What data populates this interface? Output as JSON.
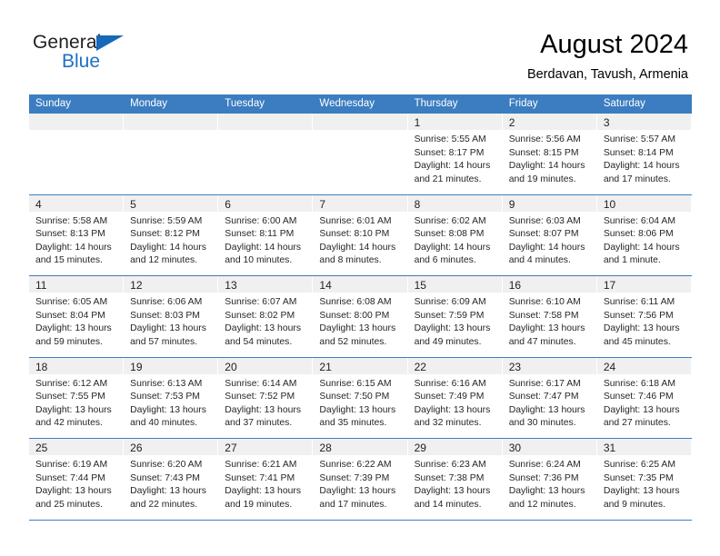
{
  "brand": {
    "line1": "General",
    "line2": "Blue",
    "flag_icon": "triangle-flag-icon",
    "accent_color": "#1569b8"
  },
  "header": {
    "title": "August 2024",
    "subtitle": "Berdavan, Tavush, Armenia"
  },
  "theme": {
    "header_blue": "#3b7dc0",
    "day_band_gray": "#f0f0f0",
    "text_color": "#262626"
  },
  "weekdays": [
    "Sunday",
    "Monday",
    "Tuesday",
    "Wednesday",
    "Thursday",
    "Friday",
    "Saturday"
  ],
  "weeks": [
    [
      {
        "day": "",
        "lines": []
      },
      {
        "day": "",
        "lines": []
      },
      {
        "day": "",
        "lines": []
      },
      {
        "day": "",
        "lines": []
      },
      {
        "day": "1",
        "lines": [
          "Sunrise: 5:55 AM",
          "Sunset: 8:17 PM",
          "Daylight: 14 hours",
          "and 21 minutes."
        ]
      },
      {
        "day": "2",
        "lines": [
          "Sunrise: 5:56 AM",
          "Sunset: 8:15 PM",
          "Daylight: 14 hours",
          "and 19 minutes."
        ]
      },
      {
        "day": "3",
        "lines": [
          "Sunrise: 5:57 AM",
          "Sunset: 8:14 PM",
          "Daylight: 14 hours",
          "and 17 minutes."
        ]
      }
    ],
    [
      {
        "day": "4",
        "lines": [
          "Sunrise: 5:58 AM",
          "Sunset: 8:13 PM",
          "Daylight: 14 hours",
          "and 15 minutes."
        ]
      },
      {
        "day": "5",
        "lines": [
          "Sunrise: 5:59 AM",
          "Sunset: 8:12 PM",
          "Daylight: 14 hours",
          "and 12 minutes."
        ]
      },
      {
        "day": "6",
        "lines": [
          "Sunrise: 6:00 AM",
          "Sunset: 8:11 PM",
          "Daylight: 14 hours",
          "and 10 minutes."
        ]
      },
      {
        "day": "7",
        "lines": [
          "Sunrise: 6:01 AM",
          "Sunset: 8:10 PM",
          "Daylight: 14 hours",
          "and 8 minutes."
        ]
      },
      {
        "day": "8",
        "lines": [
          "Sunrise: 6:02 AM",
          "Sunset: 8:08 PM",
          "Daylight: 14 hours",
          "and 6 minutes."
        ]
      },
      {
        "day": "9",
        "lines": [
          "Sunrise: 6:03 AM",
          "Sunset: 8:07 PM",
          "Daylight: 14 hours",
          "and 4 minutes."
        ]
      },
      {
        "day": "10",
        "lines": [
          "Sunrise: 6:04 AM",
          "Sunset: 8:06 PM",
          "Daylight: 14 hours",
          "and 1 minute."
        ]
      }
    ],
    [
      {
        "day": "11",
        "lines": [
          "Sunrise: 6:05 AM",
          "Sunset: 8:04 PM",
          "Daylight: 13 hours",
          "and 59 minutes."
        ]
      },
      {
        "day": "12",
        "lines": [
          "Sunrise: 6:06 AM",
          "Sunset: 8:03 PM",
          "Daylight: 13 hours",
          "and 57 minutes."
        ]
      },
      {
        "day": "13",
        "lines": [
          "Sunrise: 6:07 AM",
          "Sunset: 8:02 PM",
          "Daylight: 13 hours",
          "and 54 minutes."
        ]
      },
      {
        "day": "14",
        "lines": [
          "Sunrise: 6:08 AM",
          "Sunset: 8:00 PM",
          "Daylight: 13 hours",
          "and 52 minutes."
        ]
      },
      {
        "day": "15",
        "lines": [
          "Sunrise: 6:09 AM",
          "Sunset: 7:59 PM",
          "Daylight: 13 hours",
          "and 49 minutes."
        ]
      },
      {
        "day": "16",
        "lines": [
          "Sunrise: 6:10 AM",
          "Sunset: 7:58 PM",
          "Daylight: 13 hours",
          "and 47 minutes."
        ]
      },
      {
        "day": "17",
        "lines": [
          "Sunrise: 6:11 AM",
          "Sunset: 7:56 PM",
          "Daylight: 13 hours",
          "and 45 minutes."
        ]
      }
    ],
    [
      {
        "day": "18",
        "lines": [
          "Sunrise: 6:12 AM",
          "Sunset: 7:55 PM",
          "Daylight: 13 hours",
          "and 42 minutes."
        ]
      },
      {
        "day": "19",
        "lines": [
          "Sunrise: 6:13 AM",
          "Sunset: 7:53 PM",
          "Daylight: 13 hours",
          "and 40 minutes."
        ]
      },
      {
        "day": "20",
        "lines": [
          "Sunrise: 6:14 AM",
          "Sunset: 7:52 PM",
          "Daylight: 13 hours",
          "and 37 minutes."
        ]
      },
      {
        "day": "21",
        "lines": [
          "Sunrise: 6:15 AM",
          "Sunset: 7:50 PM",
          "Daylight: 13 hours",
          "and 35 minutes."
        ]
      },
      {
        "day": "22",
        "lines": [
          "Sunrise: 6:16 AM",
          "Sunset: 7:49 PM",
          "Daylight: 13 hours",
          "and 32 minutes."
        ]
      },
      {
        "day": "23",
        "lines": [
          "Sunrise: 6:17 AM",
          "Sunset: 7:47 PM",
          "Daylight: 13 hours",
          "and 30 minutes."
        ]
      },
      {
        "day": "24",
        "lines": [
          "Sunrise: 6:18 AM",
          "Sunset: 7:46 PM",
          "Daylight: 13 hours",
          "and 27 minutes."
        ]
      }
    ],
    [
      {
        "day": "25",
        "lines": [
          "Sunrise: 6:19 AM",
          "Sunset: 7:44 PM",
          "Daylight: 13 hours",
          "and 25 minutes."
        ]
      },
      {
        "day": "26",
        "lines": [
          "Sunrise: 6:20 AM",
          "Sunset: 7:43 PM",
          "Daylight: 13 hours",
          "and 22 minutes."
        ]
      },
      {
        "day": "27",
        "lines": [
          "Sunrise: 6:21 AM",
          "Sunset: 7:41 PM",
          "Daylight: 13 hours",
          "and 19 minutes."
        ]
      },
      {
        "day": "28",
        "lines": [
          "Sunrise: 6:22 AM",
          "Sunset: 7:39 PM",
          "Daylight: 13 hours",
          "and 17 minutes."
        ]
      },
      {
        "day": "29",
        "lines": [
          "Sunrise: 6:23 AM",
          "Sunset: 7:38 PM",
          "Daylight: 13 hours",
          "and 14 minutes."
        ]
      },
      {
        "day": "30",
        "lines": [
          "Sunrise: 6:24 AM",
          "Sunset: 7:36 PM",
          "Daylight: 13 hours",
          "and 12 minutes."
        ]
      },
      {
        "day": "31",
        "lines": [
          "Sunrise: 6:25 AM",
          "Sunset: 7:35 PM",
          "Daylight: 13 hours",
          "and 9 minutes."
        ]
      }
    ]
  ]
}
